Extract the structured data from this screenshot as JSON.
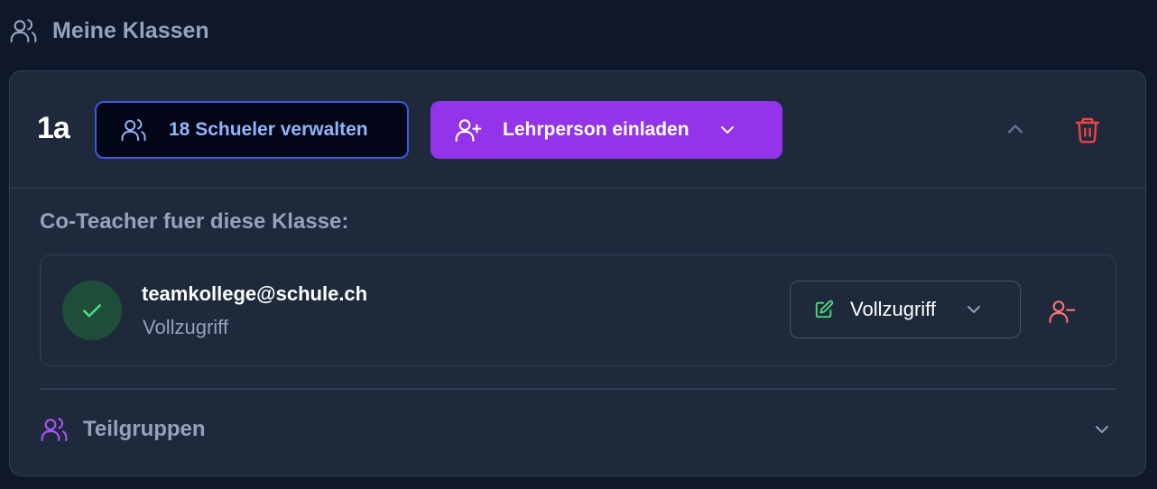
{
  "header": {
    "title": "Meine Klassen",
    "icon": "users-icon"
  },
  "class": {
    "name": "1a",
    "students_button": "18 Schueler verwalten",
    "invite_button": "Lehrperson einladen",
    "colors": {
      "invite": "#9333ea",
      "students_border": "#3b5bdb",
      "delete": "#ef4444"
    }
  },
  "coteachers": {
    "label": "Co-Teacher fuer diese Klasse:",
    "items": [
      {
        "email": "teamkollege@schule.ch",
        "role": "Vollzugriff",
        "access": "Vollzugriff",
        "status": "check-icon"
      }
    ]
  },
  "subgroups": {
    "label": "Teilgruppen"
  }
}
